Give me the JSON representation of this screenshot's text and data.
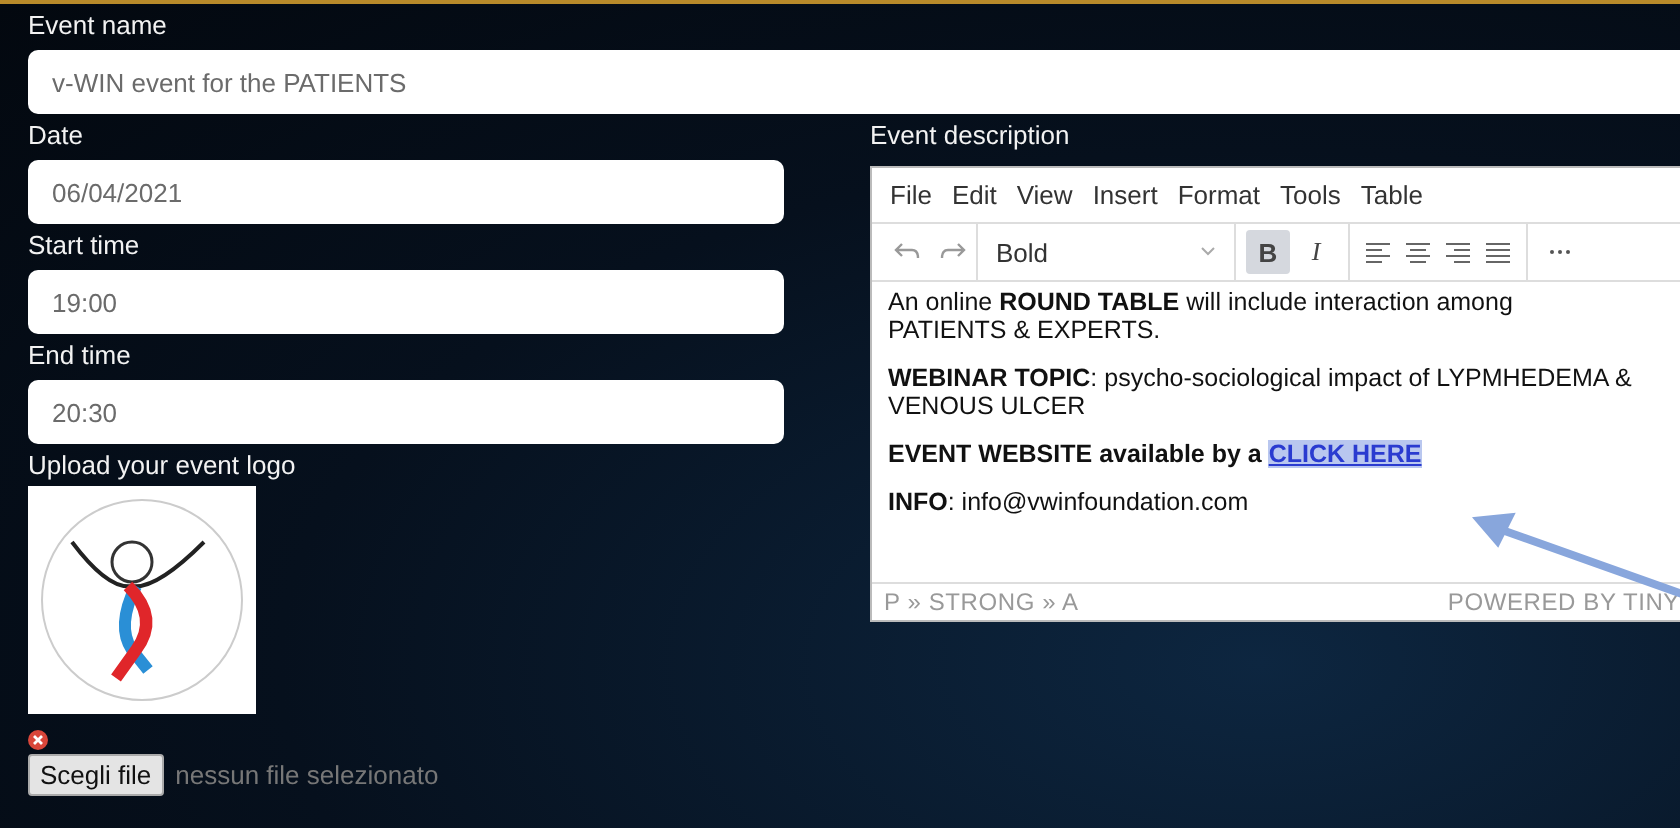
{
  "event_name": {
    "label": "Event name",
    "value": "v-WIN event for the PATIENTS"
  },
  "date": {
    "label": "Date",
    "value": "06/04/2021"
  },
  "start_time": {
    "label": "Start time",
    "value": "19:00"
  },
  "end_time": {
    "label": "End time",
    "value": "20:30"
  },
  "logo": {
    "label": "Upload your event logo",
    "file_button": "Scegli file",
    "file_status": "nessun file selezionato"
  },
  "description": {
    "label": "Event description",
    "menu": [
      "File",
      "Edit",
      "View",
      "Insert",
      "Format",
      "Tools",
      "Table"
    ],
    "toolbar": {
      "block_format": "Bold",
      "bold_label": "B",
      "italic_label": "I",
      "bold_active": true,
      "italic_active": false
    },
    "paragraphs": [
      {
        "text": "An online **ROUND TABLE** will include interaction among PATIENTS & EXPERTS."
      },
      {
        "text": "**WEBINAR TOPIC**: psycho-sociological impact of LYPMHEDEMA & VENOUS ULCER"
      },
      {
        "text": "**EVENT WEBSITE available by a** ",
        "link": "CLICK HERE"
      },
      {
        "text": "**INFO**: info@vwinfoundation.com"
      }
    ],
    "path": "P » STRONG » A",
    "branding": "POWERED BY TINY"
  }
}
